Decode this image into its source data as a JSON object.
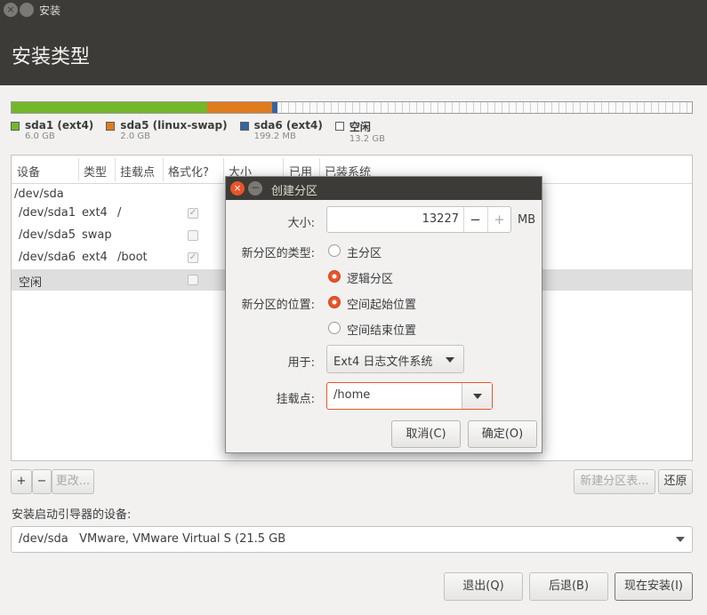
{
  "window": {
    "title": "安装"
  },
  "header": {
    "title": "安装类型"
  },
  "partition_bar": {
    "segments": [
      {
        "name": "sda1 (ext4)",
        "size": "6.0 GB",
        "color": "#73b82b",
        "weight": 6.0
      },
      {
        "name": "sda5 (linux-swap)",
        "size": "2.0 GB",
        "color": "#e07c1e",
        "weight": 2.0
      },
      {
        "name": "sda6 (ext4)",
        "size": "199.2 MB",
        "color": "#3465a4",
        "weight": 0.2
      },
      {
        "name": "空闲",
        "size": "13.2 GB",
        "color": "#fafafa",
        "weight": 13.2
      }
    ]
  },
  "table": {
    "headers": [
      "设备",
      "类型",
      "挂载点",
      "格式化?",
      "大小",
      "已用",
      "已装系统"
    ],
    "rows": [
      {
        "device": "/dev/sda",
        "type": "",
        "mount": "",
        "format": null
      },
      {
        "device": "/dev/sda1",
        "type": "ext4",
        "mount": "/",
        "format": true
      },
      {
        "device": "/dev/sda5",
        "type": "swap",
        "mount": "",
        "format": false
      },
      {
        "device": "/dev/sda6",
        "type": "ext4",
        "mount": "/boot",
        "format": true
      },
      {
        "device": "空闲",
        "type": "",
        "mount": "",
        "format": false,
        "selected": true
      }
    ]
  },
  "toolbar": {
    "add": "+",
    "remove": "−",
    "change": "更改...",
    "new_table": "新建分区表...",
    "revert": "还原"
  },
  "boot": {
    "label": "安装启动引导器的设备:",
    "device": "/dev/sda",
    "description": "VMware, VMware Virtual S (21.5 GB"
  },
  "footer": {
    "quit": "退出(Q)",
    "back": "后退(B)",
    "install": "现在安装(I)"
  },
  "dialog": {
    "title": "创建分区",
    "size_label": "大小:",
    "size_value": "13227",
    "size_unit": "MB",
    "minus": "−",
    "plus": "+",
    "type_label": "新分区的类型:",
    "type_options": [
      "主分区",
      "逻辑分区"
    ],
    "type_selected": 1,
    "location_label": "新分区的位置:",
    "location_options": [
      "空间起始位置",
      "空间结束位置"
    ],
    "location_selected": 0,
    "use_label": "用于:",
    "use_value": "Ext4 日志文件系统",
    "mount_label": "挂载点:",
    "mount_value": "/home",
    "cancel": "取消(C)",
    "ok": "确定(O)"
  }
}
